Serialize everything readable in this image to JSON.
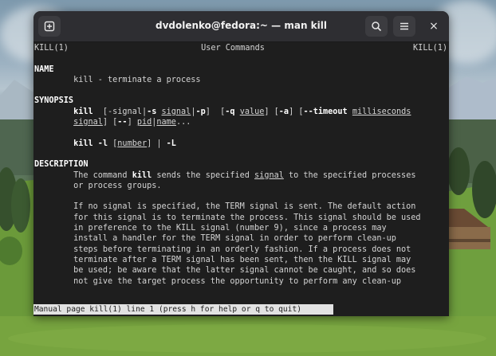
{
  "window": {
    "title": "dvdolenko@fedora:~ — man kill",
    "new_tab_icon": "new-tab-icon",
    "search_icon": "search-icon",
    "menu_icon": "hamburger-menu-icon",
    "close_label": "×"
  },
  "man": {
    "header_left": "KILL(1)",
    "header_center": "User Commands",
    "header_right": "KILL(1)",
    "sec_name": "NAME",
    "name_line": "kill - terminate a process",
    "sec_synopsis": "SYNOPSIS",
    "syn1_cmd": "kill",
    "syn1_a": "  [-signal|",
    "syn1_b": "-s",
    "syn1_c": " ",
    "syn1_signal": "signal",
    "syn1_d": "|",
    "syn1_e": "-p",
    "syn1_f": "]  [",
    "syn1_g": "-q",
    "syn1_h": " ",
    "syn1_value": "value",
    "syn1_i": "] [",
    "syn1_j": "-a",
    "syn1_k": "] [",
    "syn1_l": "--timeout",
    "syn1_m": " ",
    "syn1_ms": "milliseconds",
    "syn2_signal": "signal",
    "syn2_a": "] [",
    "syn2_b": "--",
    "syn2_c": "] ",
    "syn2_pid": "pid",
    "syn2_d": "|",
    "syn2_name": "name",
    "syn2_e": "...",
    "syn3_cmd": "kill -l",
    "syn3_a": " [",
    "syn3_number": "number",
    "syn3_b": "] | ",
    "syn3_c": "-L",
    "sec_description": "DESCRIPTION",
    "desc1_a": "The command ",
    "desc1_kill": "kill",
    "desc1_b": " sends the specified ",
    "desc1_signal": "signal",
    "desc1_c": " to the specified processes",
    "desc2": "or process groups.",
    "p2": [
      "If no signal is specified, the TERM signal is sent. The default action",
      "for this signal is to terminate the process. This signal should be used",
      "in preference to the KILL signal (number 9), since a process may",
      "install a handler for the TERM signal in order to perform clean-up",
      "steps before terminating in an orderly fashion. If a process does not",
      "terminate after a TERM signal has been sent, then the KILL signal may",
      "be used; be aware that the latter signal cannot be caught, and so does",
      "not give the target process the opportunity to perform any clean-up"
    ]
  },
  "status": {
    "text": "Manual page kill(1) line 1 (press h for help or q to quit)"
  }
}
